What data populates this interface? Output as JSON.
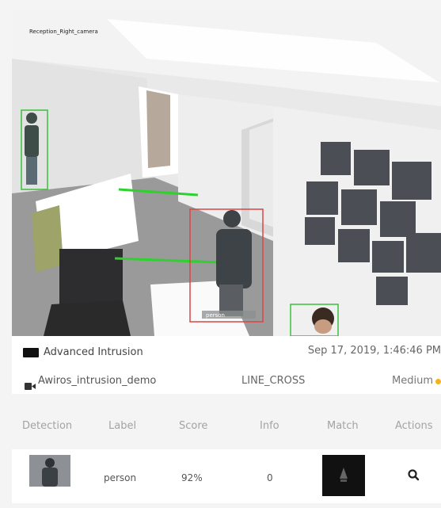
{
  "camera_view": {
    "overlay_text": "Reception_Right_camera",
    "bbox_label_text": "person"
  },
  "alert": {
    "title": "Advanced Intrusion",
    "timestamp": "Sep 17, 2019, 1:46:46 PM",
    "camera_icon": "video-camera-icon",
    "camera_name": "Awiros_intrusion_demo",
    "event_type": "LINE_CROSS",
    "severity": "Medium",
    "severity_color": "#f5b21b"
  },
  "table": {
    "headers": [
      "Detection",
      "Label",
      "Score",
      "Info",
      "Match",
      "Actions"
    ],
    "rows": [
      {
        "label": "person",
        "score": "92%",
        "info": "0",
        "action_icon": "search-icon"
      }
    ]
  },
  "colors": {
    "line_cross": "#2fd12f",
    "box_red": "#d94646",
    "box_green": "#3bbf3b"
  }
}
